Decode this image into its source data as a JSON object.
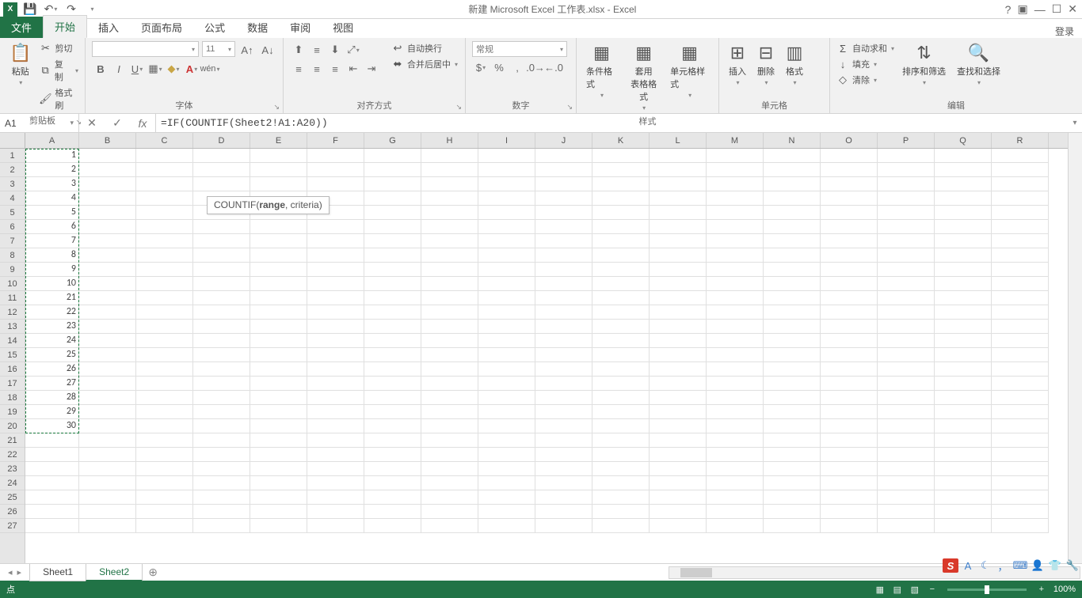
{
  "title": "新建 Microsoft Excel 工作表.xlsx - Excel",
  "login": "登录",
  "tabs": {
    "file": "文件",
    "home": "开始",
    "insert": "插入",
    "layout": "页面布局",
    "formulas": "公式",
    "data": "数据",
    "review": "审阅",
    "view": "视图"
  },
  "ribbon": {
    "clipboard": {
      "paste": "粘贴",
      "cut": "剪切",
      "copy": "复制",
      "format_painter": "格式刷",
      "label": "剪贴板"
    },
    "font": {
      "size": "11",
      "label": "字体"
    },
    "align": {
      "wrap": "自动换行",
      "merge": "合并后居中",
      "label": "对齐方式"
    },
    "number": {
      "format": "常规",
      "label": "数字"
    },
    "styles": {
      "cond": "条件格式",
      "table": "套用\n表格格式",
      "cell": "单元格样式",
      "label": "样式"
    },
    "cells": {
      "insert": "插入",
      "delete": "删除",
      "format": "格式",
      "label": "单元格"
    },
    "editing": {
      "autosum": "自动求和",
      "fill": "填充",
      "clear": "清除",
      "sort": "排序和筛选",
      "find": "查找和选择",
      "label": "编辑"
    }
  },
  "namebox": "A1",
  "formula": "=IF(COUNTIF(Sheet2!A1:A20))",
  "tooltip_fn": "COUNTIF(",
  "tooltip_arg1": "range",
  "tooltip_rest": ", criteria)",
  "columns": [
    "A",
    "B",
    "C",
    "D",
    "E",
    "F",
    "G",
    "H",
    "I",
    "J",
    "K",
    "L",
    "M",
    "N",
    "O",
    "P",
    "Q",
    "R"
  ],
  "rows": [
    1,
    2,
    3,
    4,
    5,
    6,
    7,
    8,
    9,
    10,
    11,
    12,
    13,
    14,
    15,
    16,
    17,
    18,
    19,
    20,
    21,
    22,
    23,
    24,
    25,
    26,
    27
  ],
  "col_a_values": [
    "1",
    "2",
    "3",
    "4",
    "5",
    "6",
    "7",
    "8",
    "9",
    "10",
    "21",
    "22",
    "23",
    "24",
    "25",
    "26",
    "27",
    "28",
    "29",
    "30",
    "",
    "",
    "",
    "",
    "",
    "",
    ""
  ],
  "sheets": {
    "s1": "Sheet1",
    "s2": "Sheet2"
  },
  "status": "点",
  "zoom": "100%"
}
